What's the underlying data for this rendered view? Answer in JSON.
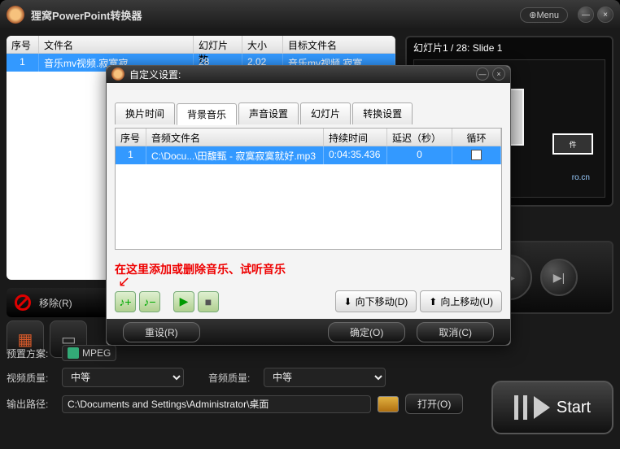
{
  "app": {
    "title": "狸窝PowerPoint转换器",
    "menu": "⊕Menu"
  },
  "main_table": {
    "columns": {
      "seq": "序号",
      "filename": "文件名",
      "slides": "幻灯片数",
      "size": "大小",
      "target": "目标文件名"
    },
    "row": {
      "seq": "1",
      "filename": "音乐mv视频.寂寞寂",
      "slides": "28",
      "size": "2.02",
      "target": "音乐mv视频 寂寞"
    }
  },
  "preview": {
    "label": "幻灯片1 / 28: Slide 1"
  },
  "remove_label": "移除(R)",
  "bottom": {
    "preset_label": "预置方案:",
    "preset_value": "MPEG",
    "video_q_label": "视频质量:",
    "video_q_value": "中等",
    "audio_q_label": "音频质量:",
    "audio_q_value": "中等",
    "output_label": "输出路径:",
    "output_value": "C:\\Documents and Settings\\Administrator\\桌面",
    "open_label": "打开(O)",
    "start_label": "Start"
  },
  "dialog": {
    "title": "自定义设置:",
    "tabs": [
      "换片时间",
      "背景音乐",
      "声音设置",
      "幻灯片",
      "转换设置"
    ],
    "active_tab": 1,
    "audio_columns": {
      "seq": "序号",
      "file": "音频文件名",
      "duration": "持续时间",
      "delay": "延迟（秒）",
      "loop": "循环"
    },
    "audio_row": {
      "seq": "1",
      "file": "C:\\Docu...\\田馥甄 - 寂寞寂寞就好.mp3",
      "duration": "0:04:35.436",
      "delay": "0"
    },
    "annotation": "在这里添加或删除音乐、试听音乐",
    "move_down": "向下移动(D)",
    "move_up": "向上移动(U)",
    "reset": "重设(R)",
    "ok": "确定(O)",
    "cancel": "取消(C)"
  }
}
